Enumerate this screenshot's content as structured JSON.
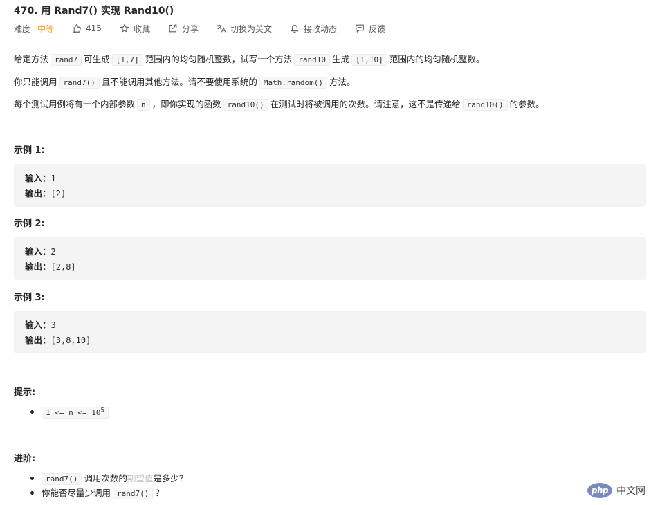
{
  "problem": {
    "title": "470. 用 Rand7() 实现 Rand10()",
    "difficulty_label": "难度",
    "difficulty_value": "中等",
    "likes": "415",
    "favorite": "收藏",
    "share": "分享",
    "switch_lang": "切换为英文",
    "subscribe": "接收动态",
    "feedback": "反馈"
  },
  "description": {
    "p1": [
      "给定方法",
      "rand7",
      "可生成",
      "[1,7]",
      "范围内的均匀随机整数，试写一个方法",
      "rand10",
      "生成",
      "[1,10]",
      "范围内的均匀随机整数。"
    ],
    "p2": [
      "你只能调用",
      "rand7()",
      "且不能调用其他方法。请不要使用系统的",
      "Math.random()",
      "方法。"
    ],
    "p3": [
      "每个测试用例将有一个内部参数",
      "n",
      "，即你实现的函数",
      "rand10()",
      "在测试时将被调用的次数。请注意，这不是传递给",
      "rand10()",
      "的参数。"
    ]
  },
  "examples": [
    {
      "heading": "示例 1:",
      "input_label": "输入：",
      "input": "1",
      "output_label": "输出：",
      "output": "[2]"
    },
    {
      "heading": "示例 2:",
      "input_label": "输入：",
      "input": "2",
      "output_label": "输出：",
      "output": "[2,8]"
    },
    {
      "heading": "示例 3:",
      "input_label": "输入：",
      "input": "3",
      "output_label": "输出：",
      "output": "[3,8,10]"
    }
  ],
  "hints": {
    "heading": "提示:",
    "constraint_prefix": "1 <= n <= 10",
    "constraint_exp": "5"
  },
  "followup": {
    "heading": "进阶:",
    "item1": [
      "rand7()",
      "调用次数的",
      "期望值",
      "是多少？"
    ],
    "item2": [
      "你能否尽量少调用",
      "rand7()",
      "？"
    ]
  },
  "watermark": {
    "logo_text": "php",
    "site_text": "中文网"
  },
  "icons": {
    "like": "thumbs-up-icon",
    "favorite": "star-icon",
    "share": "share-icon",
    "switch_lang": "translate-icon",
    "subscribe": "bell-icon",
    "feedback": "message-icon"
  }
}
